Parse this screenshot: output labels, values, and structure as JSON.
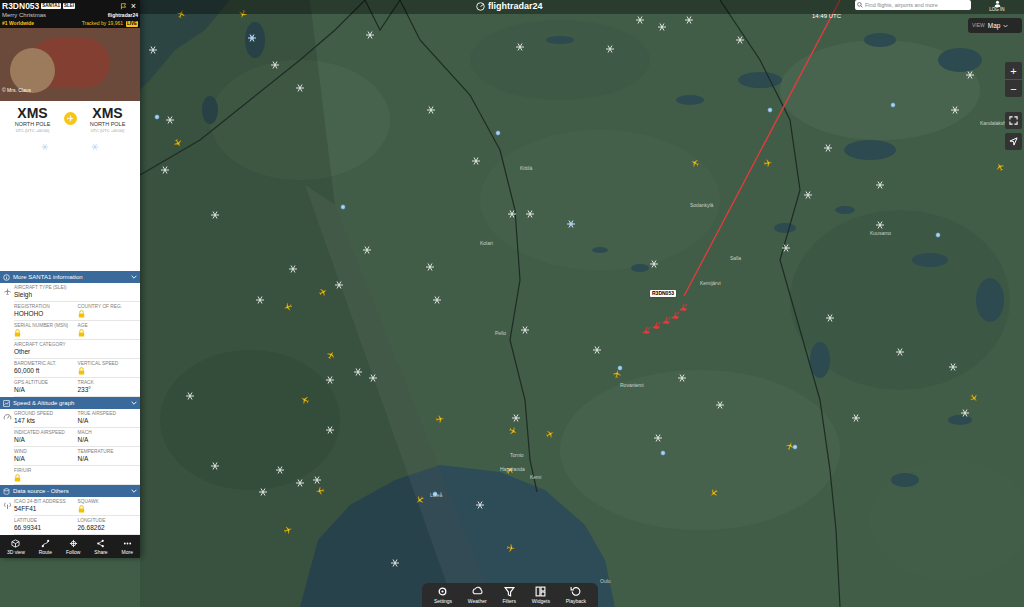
{
  "topbar": {
    "logo": "flightradar24",
    "time": "14:49 UTC",
    "search": {
      "placeholder": "Find flights, airports and more"
    },
    "login": "LOG IN",
    "view": {
      "label": "VIEW",
      "value": "Map"
    }
  },
  "flight_panel": {
    "callsign": "R3DN053",
    "badges": [
      "SANTA1",
      "SLEI"
    ],
    "close": "×",
    "subtitle": "Merry Christmas",
    "brand": "flightradar24",
    "rank": "#1 Worldwide",
    "tracked": "Tracked by 19,961",
    "live": "LIVE",
    "photo_credit": "© Mrs. Claus",
    "origin": {
      "code": "XMS",
      "name": "NORTH POLE",
      "tz": "UTC (UTC +00:00)"
    },
    "destination": {
      "code": "XMS",
      "name": "NORTH POLE",
      "tz": "UTC (UTC +00:00)"
    },
    "sections": [
      {
        "title": "More SANTA1 information",
        "expanded": true,
        "rows": [
          [
            {
              "label": "AIRCRAFT TYPE (SLEI)",
              "value": "Sleigh",
              "locked": false
            }
          ],
          [
            {
              "label": "REGISTRATION",
              "value": "HOHOHO",
              "locked": false
            },
            {
              "label": "COUNTRY OF REG.",
              "locked": true
            }
          ],
          [
            {
              "label": "SERIAL NUMBER (MSN)",
              "locked": true
            },
            {
              "label": "AGE",
              "locked": true
            }
          ],
          [
            {
              "label": "AIRCRAFT CATEGORY",
              "value": "Other",
              "locked": false
            }
          ],
          [
            {
              "label": "BAROMETRIC ALT.",
              "value": "60,000 ft",
              "locked": false
            },
            {
              "label": "VERTICAL SPEED",
              "locked": true
            }
          ],
          [
            {
              "label": "GPS ALTITUDE",
              "value": "N/A",
              "locked": false
            },
            {
              "label": "TRACK",
              "value": "233°",
              "locked": false
            }
          ]
        ]
      },
      {
        "title": "Speed & Altitude graph",
        "expanded": true,
        "rows": [
          [
            {
              "label": "GROUND SPEED",
              "value": "147 kts",
              "locked": false
            },
            {
              "label": "TRUE AIRSPEED",
              "value": "N/A",
              "locked": false
            }
          ],
          [
            {
              "label": "INDICATED AIRSPEED",
              "value": "N/A",
              "locked": false
            },
            {
              "label": "MACH",
              "value": "N/A",
              "locked": false
            }
          ],
          [
            {
              "label": "WIND",
              "value": "N/A",
              "locked": false
            },
            {
              "label": "TEMPERATURE",
              "value": "N/A",
              "locked": false
            }
          ],
          [
            {
              "label": "FIR/UIR",
              "locked": true
            }
          ]
        ]
      },
      {
        "title": "Data source - Others",
        "expanded": true,
        "rows": [
          [
            {
              "label": "ICAO 24-BIT ADDRESS",
              "value": "54FF41",
              "locked": false
            },
            {
              "label": "SQUAWK",
              "locked": true
            }
          ],
          [
            {
              "label": "LATITUDE",
              "value": "66.99341",
              "locked": false
            },
            {
              "label": "LONGITUDE",
              "value": "26.68262",
              "locked": false
            }
          ]
        ]
      }
    ],
    "actions": [
      {
        "label": "3D view"
      },
      {
        "label": "Route"
      },
      {
        "label": "Follow"
      },
      {
        "label": "Share"
      },
      {
        "label": "More"
      }
    ]
  },
  "map": {
    "flight_label": "R3DN053",
    "zoom": [
      "+",
      "−"
    ],
    "places": [
      "Kittilä",
      "Sodankylä",
      "Pello",
      "Kolari",
      "Rovaniemi",
      "Kemijärvi",
      "Salla",
      "Tornio",
      "Haparanda",
      "Kemi",
      "Luleå",
      "Oulu",
      "Kuusamo",
      "Kandalaksha"
    ]
  },
  "toolbar": [
    {
      "label": "Settings"
    },
    {
      "label": "Weather"
    },
    {
      "label": "Filters"
    },
    {
      "label": "Widgets"
    },
    {
      "label": "Playback"
    }
  ]
}
